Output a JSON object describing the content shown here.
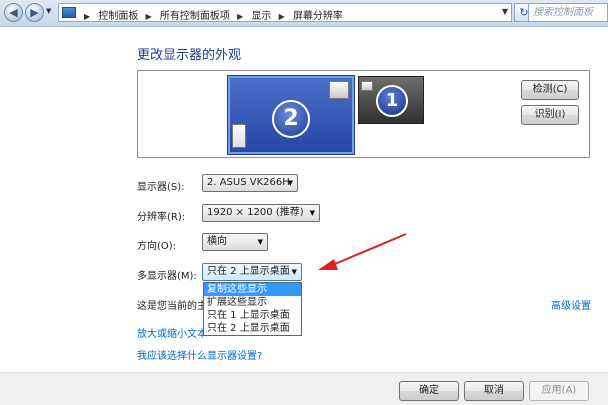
{
  "breadcrumb": [
    "控制面板",
    "所有控制面板项",
    "显示",
    "屏幕分辨率"
  ],
  "search_placeholder": "搜索控制面板",
  "heading": "更改显示器的外观",
  "monitors": {
    "secondary_number": "2",
    "primary_number": "1"
  },
  "buttons": {
    "detect": "检测(C)",
    "identify": "识别(I)",
    "ok": "确定",
    "cancel": "取消",
    "apply": "应用(A)"
  },
  "form": {
    "display_label": "显示器(S):",
    "display_value": "2. ASUS VK266H",
    "resolution_label": "分辨率(R):",
    "resolution_value": "1920 × 1200 (推荐)",
    "orientation_label": "方向(O):",
    "orientation_value": "横向",
    "multi_label": "多显示器(M):",
    "multi_value": "只在 2 上显示桌面"
  },
  "multi_options": [
    "复制这些显示",
    "扩展这些显示",
    "只在 1 上显示桌面",
    "只在 2 上显示桌面"
  ],
  "status_text_visible": "这是您当前的主",
  "advanced_link": "高级设置",
  "text_size_link_visible": "放大或缩小文本",
  "help_link": "我应该选择什么显示器设置?",
  "annotation_color": "#e02020"
}
